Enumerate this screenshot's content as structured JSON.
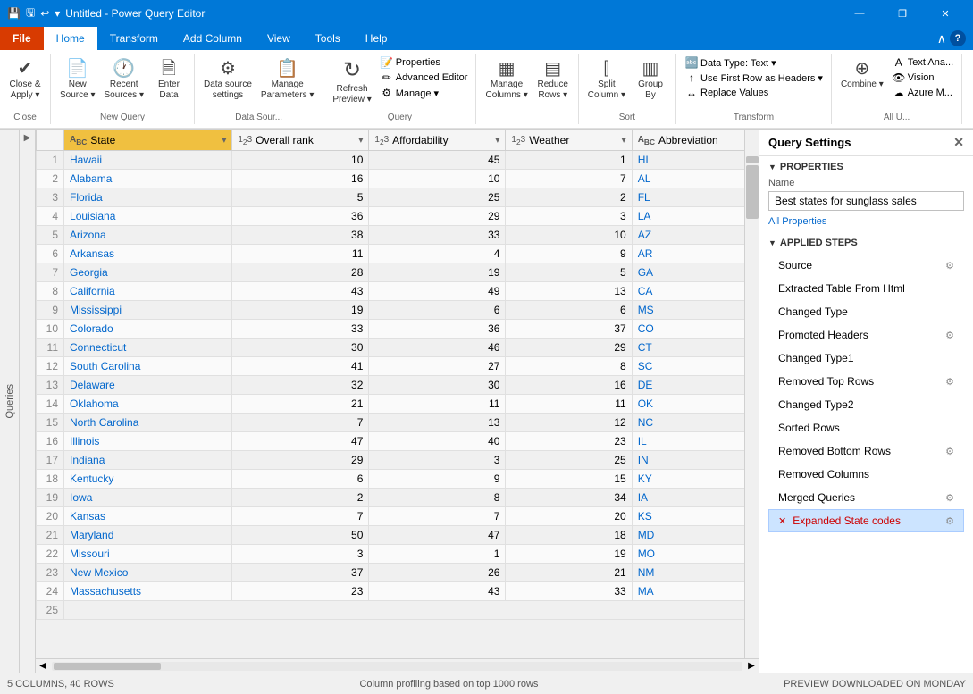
{
  "titleBar": {
    "title": "Untitled - Power Query Editor",
    "icon": "📊",
    "controls": [
      "—",
      "❐",
      "✕"
    ]
  },
  "ribbon": {
    "tabs": [
      "File",
      "Home",
      "Transform",
      "Add Column",
      "View",
      "Tools",
      "Help"
    ],
    "activeTab": "Home",
    "groups": [
      {
        "name": "Close",
        "items": [
          {
            "label": "Close &\nApply",
            "icon": "✔",
            "type": "large",
            "dropdown": true
          }
        ]
      },
      {
        "name": "New Query",
        "items": [
          {
            "label": "New\nSource",
            "icon": "📄",
            "type": "large",
            "dropdown": true
          },
          {
            "label": "Recent\nSources",
            "icon": "🕐",
            "type": "large",
            "dropdown": true
          },
          {
            "label": "Enter\nData",
            "icon": "🗎",
            "type": "large"
          }
        ]
      },
      {
        "name": "Data Sour...",
        "items": [
          {
            "label": "Data source\nsettings",
            "icon": "⚙",
            "type": "large"
          },
          {
            "label": "Manage\nParameters",
            "icon": "📋",
            "type": "large",
            "dropdown": true
          }
        ]
      },
      {
        "name": "Query",
        "items": [
          {
            "label": "Refresh\nPreview",
            "icon": "↻",
            "type": "large",
            "dropdown": true
          },
          {
            "label": "Properties",
            "icon": "📝",
            "type": "small"
          },
          {
            "label": "Advanced Editor",
            "icon": "✏",
            "type": "small"
          },
          {
            "label": "Manage ▾",
            "icon": "⚙",
            "type": "small"
          }
        ]
      },
      {
        "name": "",
        "items": [
          {
            "label": "Manage\nColumns",
            "icon": "▦",
            "type": "large",
            "dropdown": true
          },
          {
            "label": "Reduce\nRows",
            "icon": "▤",
            "type": "large",
            "dropdown": true
          }
        ]
      },
      {
        "name": "Sort",
        "items": [
          {
            "label": "Split\nColumn",
            "icon": "⫿",
            "type": "large",
            "dropdown": true
          },
          {
            "label": "Group\nBy",
            "icon": "▥",
            "type": "large"
          }
        ]
      },
      {
        "name": "Transform",
        "items": [
          {
            "label": "Data Type: Text ▾",
            "icon": "🔤",
            "type": "small"
          },
          {
            "label": "Use First Row as Headers ▾",
            "icon": "↑",
            "type": "small"
          },
          {
            "label": "Replace Values",
            "icon": "↔",
            "type": "small"
          }
        ]
      },
      {
        "name": "All U...",
        "items": [
          {
            "label": "Combine",
            "icon": "⊕",
            "type": "large",
            "dropdown": true
          },
          {
            "label": "Text Ana...",
            "icon": "A",
            "type": "small"
          },
          {
            "label": "Vision",
            "icon": "👁",
            "type": "small"
          },
          {
            "label": "Azure M...",
            "icon": "☁",
            "type": "small"
          }
        ]
      }
    ]
  },
  "columns": [
    {
      "name": "State",
      "type": "ABC",
      "highlighted": true
    },
    {
      "name": "Overall rank",
      "type": "123"
    },
    {
      "name": "Affordability",
      "type": "123"
    },
    {
      "name": "Weather",
      "type": "123"
    },
    {
      "name": "Abbreviation",
      "type": "ABC"
    }
  ],
  "rows": [
    {
      "num": 1,
      "state": "Hawaii",
      "rank": 10,
      "afford": 45,
      "weather": 1,
      "abbr": "HI"
    },
    {
      "num": 2,
      "state": "Alabama",
      "rank": 16,
      "afford": 10,
      "weather": 7,
      "abbr": "AL"
    },
    {
      "num": 3,
      "state": "Florida",
      "rank": 5,
      "afford": 25,
      "weather": 2,
      "abbr": "FL"
    },
    {
      "num": 4,
      "state": "Louisiana",
      "rank": 36,
      "afford": 29,
      "weather": 3,
      "abbr": "LA"
    },
    {
      "num": 5,
      "state": "Arizona",
      "rank": 38,
      "afford": 33,
      "weather": 10,
      "abbr": "AZ"
    },
    {
      "num": 6,
      "state": "Arkansas",
      "rank": 11,
      "afford": 4,
      "weather": 9,
      "abbr": "AR"
    },
    {
      "num": 7,
      "state": "Georgia",
      "rank": 28,
      "afford": 19,
      "weather": 5,
      "abbr": "GA"
    },
    {
      "num": 8,
      "state": "California",
      "rank": 43,
      "afford": 49,
      "weather": 13,
      "abbr": "CA"
    },
    {
      "num": 9,
      "state": "Mississippi",
      "rank": 19,
      "afford": 6,
      "weather": 6,
      "abbr": "MS"
    },
    {
      "num": 10,
      "state": "Colorado",
      "rank": 33,
      "afford": 36,
      "weather": 37,
      "abbr": "CO"
    },
    {
      "num": 11,
      "state": "Connecticut",
      "rank": 30,
      "afford": 46,
      "weather": 29,
      "abbr": "CT"
    },
    {
      "num": 12,
      "state": "South Carolina",
      "rank": 41,
      "afford": 27,
      "weather": 8,
      "abbr": "SC"
    },
    {
      "num": 13,
      "state": "Delaware",
      "rank": 32,
      "afford": 30,
      "weather": 16,
      "abbr": "DE"
    },
    {
      "num": 14,
      "state": "Oklahoma",
      "rank": 21,
      "afford": 11,
      "weather": 11,
      "abbr": "OK"
    },
    {
      "num": 15,
      "state": "North Carolina",
      "rank": 7,
      "afford": 13,
      "weather": 12,
      "abbr": "NC"
    },
    {
      "num": 16,
      "state": "Illinois",
      "rank": 47,
      "afford": 40,
      "weather": 23,
      "abbr": "IL"
    },
    {
      "num": 17,
      "state": "Indiana",
      "rank": 29,
      "afford": 3,
      "weather": 25,
      "abbr": "IN"
    },
    {
      "num": 18,
      "state": "Kentucky",
      "rank": 6,
      "afford": 9,
      "weather": 15,
      "abbr": "KY"
    },
    {
      "num": 19,
      "state": "Iowa",
      "rank": 2,
      "afford": 8,
      "weather": 34,
      "abbr": "IA"
    },
    {
      "num": 20,
      "state": "Kansas",
      "rank": 7,
      "afford": 7,
      "weather": 20,
      "abbr": "KS"
    },
    {
      "num": 21,
      "state": "Maryland",
      "rank": 50,
      "afford": 47,
      "weather": 18,
      "abbr": "MD"
    },
    {
      "num": 22,
      "state": "Missouri",
      "rank": 3,
      "afford": 1,
      "weather": 19,
      "abbr": "MO"
    },
    {
      "num": 23,
      "state": "New Mexico",
      "rank": 37,
      "afford": 26,
      "weather": 21,
      "abbr": "NM"
    },
    {
      "num": 24,
      "state": "Massachusetts",
      "rank": 23,
      "afford": 43,
      "weather": 33,
      "abbr": "MA"
    },
    {
      "num": 25,
      "state": "...",
      "rank": "",
      "afford": "",
      "weather": "",
      "abbr": ""
    }
  ],
  "querySettings": {
    "title": "Query Settings",
    "propertiesSection": "PROPERTIES",
    "nameLabel": "Name",
    "nameValue": "Best states for sunglass sales",
    "allPropertiesLink": "All Properties",
    "stepsSection": "APPLIED STEPS",
    "steps": [
      {
        "name": "Source",
        "hasGear": true,
        "error": false
      },
      {
        "name": "Extracted Table From Html",
        "hasGear": false,
        "error": false
      },
      {
        "name": "Changed Type",
        "hasGear": false,
        "error": false
      },
      {
        "name": "Promoted Headers",
        "hasGear": true,
        "error": false
      },
      {
        "name": "Changed Type1",
        "hasGear": false,
        "error": false
      },
      {
        "name": "Removed Top Rows",
        "hasGear": true,
        "error": false
      },
      {
        "name": "Changed Type2",
        "hasGear": false,
        "error": false
      },
      {
        "name": "Sorted Rows",
        "hasGear": false,
        "error": false
      },
      {
        "name": "Removed Bottom Rows",
        "hasGear": true,
        "error": false
      },
      {
        "name": "Removed Columns",
        "hasGear": false,
        "error": false
      },
      {
        "name": "Merged Queries",
        "hasGear": true,
        "error": false
      },
      {
        "name": "Expanded State codes",
        "hasGear": true,
        "error": true,
        "active": true
      }
    ]
  },
  "statusBar": {
    "left": "5 COLUMNS, 40 ROWS",
    "middle": "Column profiling based on top 1000 rows",
    "right": "PREVIEW DOWNLOADED ON MONDAY"
  }
}
